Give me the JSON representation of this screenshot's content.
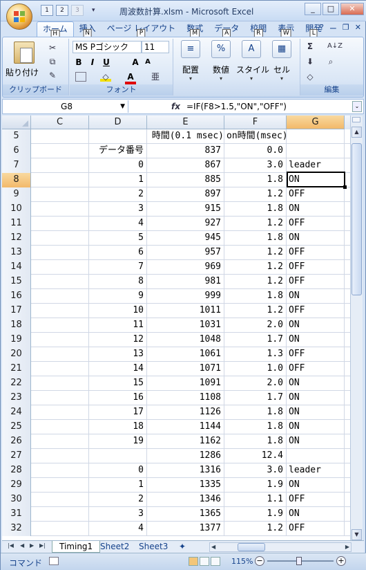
{
  "window": {
    "title": "周波数計算.xlsm - Microsoft Excel",
    "qat_keys": [
      "1",
      "2",
      "3"
    ],
    "controls": {
      "help": "?",
      "minimize": "ー",
      "restore": "❐",
      "close": "✕"
    }
  },
  "ribbon": {
    "tabs": [
      {
        "label": "ホーム",
        "key": "H"
      },
      {
        "label": "挿入",
        "key": "N"
      },
      {
        "label": "ページ レイアウト",
        "key": "P"
      },
      {
        "label": "数式",
        "key": "M"
      },
      {
        "label": "データ",
        "key": "A"
      },
      {
        "label": "校閲",
        "key": "R"
      },
      {
        "label": "表示",
        "key": "W"
      },
      {
        "label": "開発",
        "key": "L"
      }
    ],
    "clipboard": {
      "paste_label": "貼り付け",
      "group_label": "クリップボード"
    },
    "font": {
      "name": "MS Pゴシック",
      "size": "11",
      "bold": "B",
      "italic": "I",
      "underline": "U",
      "grow": "A",
      "shrink": "A",
      "font_color": "A",
      "group_label": "フォント"
    },
    "alignment_label": "配置",
    "number_label": "数値",
    "style_label": "スタイル",
    "cells_label": "セル",
    "editing": {
      "sum": "Σ",
      "sort": "A↓Z",
      "group_label": "編集"
    }
  },
  "formula_bar": {
    "name_box": "G8",
    "fx": "fx",
    "formula": "=IF(F8>1.5,\"ON\",\"OFF\")"
  },
  "grid": {
    "columns": [
      "C",
      "D",
      "E",
      "F",
      "G"
    ],
    "selected_column": "G",
    "selected_row": "8",
    "rows": [
      {
        "n": "5",
        "D": "",
        "E": "時間(0.1 msec)",
        "F": "on時間(msec)",
        "G": ""
      },
      {
        "n": "6",
        "D": "データ番号",
        "E": "837",
        "F": "0.0",
        "G": ""
      },
      {
        "n": "7",
        "D": "0",
        "E": "867",
        "F": "3.0",
        "G": "leader"
      },
      {
        "n": "8",
        "D": "1",
        "E": "885",
        "F": "1.8",
        "G": "ON"
      },
      {
        "n": "9",
        "D": "2",
        "E": "897",
        "F": "1.2",
        "G": "OFF"
      },
      {
        "n": "10",
        "D": "3",
        "E": "915",
        "F": "1.8",
        "G": "ON"
      },
      {
        "n": "11",
        "D": "4",
        "E": "927",
        "F": "1.2",
        "G": "OFF"
      },
      {
        "n": "12",
        "D": "5",
        "E": "945",
        "F": "1.8",
        "G": "ON"
      },
      {
        "n": "13",
        "D": "6",
        "E": "957",
        "F": "1.2",
        "G": "OFF"
      },
      {
        "n": "14",
        "D": "7",
        "E": "969",
        "F": "1.2",
        "G": "OFF"
      },
      {
        "n": "15",
        "D": "8",
        "E": "981",
        "F": "1.2",
        "G": "OFF"
      },
      {
        "n": "16",
        "D": "9",
        "E": "999",
        "F": "1.8",
        "G": "ON"
      },
      {
        "n": "17",
        "D": "10",
        "E": "1011",
        "F": "1.2",
        "G": "OFF"
      },
      {
        "n": "18",
        "D": "11",
        "E": "1031",
        "F": "2.0",
        "G": "ON"
      },
      {
        "n": "19",
        "D": "12",
        "E": "1048",
        "F": "1.7",
        "G": "ON"
      },
      {
        "n": "20",
        "D": "13",
        "E": "1061",
        "F": "1.3",
        "G": "OFF"
      },
      {
        "n": "21",
        "D": "14",
        "E": "1071",
        "F": "1.0",
        "G": "OFF"
      },
      {
        "n": "22",
        "D": "15",
        "E": "1091",
        "F": "2.0",
        "G": "ON"
      },
      {
        "n": "23",
        "D": "16",
        "E": "1108",
        "F": "1.7",
        "G": "ON"
      },
      {
        "n": "24",
        "D": "17",
        "E": "1126",
        "F": "1.8",
        "G": "ON"
      },
      {
        "n": "25",
        "D": "18",
        "E": "1144",
        "F": "1.8",
        "G": "ON"
      },
      {
        "n": "26",
        "D": "19",
        "E": "1162",
        "F": "1.8",
        "G": "ON"
      },
      {
        "n": "27",
        "D": "",
        "E": "1286",
        "F": "12.4",
        "G": ""
      },
      {
        "n": "28",
        "D": "0",
        "E": "1316",
        "F": "3.0",
        "G": "leader"
      },
      {
        "n": "29",
        "D": "1",
        "E": "1335",
        "F": "1.9",
        "G": "ON"
      },
      {
        "n": "30",
        "D": "2",
        "E": "1346",
        "F": "1.1",
        "G": "OFF"
      },
      {
        "n": "31",
        "D": "3",
        "E": "1365",
        "F": "1.9",
        "G": "ON"
      },
      {
        "n": "32",
        "D": "4",
        "E": "1377",
        "F": "1.2",
        "G": "OFF"
      }
    ]
  },
  "sheets": [
    "Timing1",
    "Sheet2",
    "Sheet3"
  ],
  "active_sheet": "Timing1",
  "status": {
    "mode": "コマンド",
    "zoom": "115%",
    "zoom_level_percent": 115
  }
}
